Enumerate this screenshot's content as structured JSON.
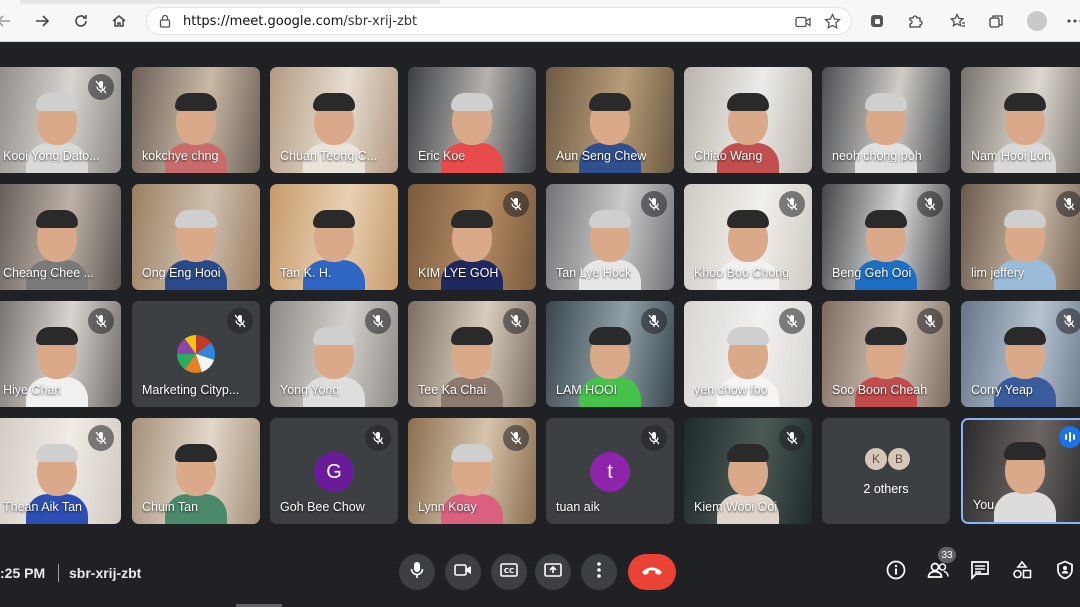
{
  "browser": {
    "url_host": "https://meet.google.com",
    "url_path": "/sbr-xrij-zbt"
  },
  "colors": {
    "tile_bg": "#3c4043",
    "end_call": "#ea4335",
    "speaking_border": "#8ab4f8",
    "avatar_g": "#6a1b9a",
    "avatar_t": "#8e24aa"
  },
  "participants": [
    {
      "name": "Kooi Yong Dato...",
      "muted": true
    },
    {
      "name": "kokchye chng",
      "muted": false
    },
    {
      "name": "Chuan Teong C...",
      "muted": false
    },
    {
      "name": "Eric Koe",
      "muted": false
    },
    {
      "name": "Aun Seng Chew",
      "muted": false
    },
    {
      "name": "Chiao Wang",
      "muted": false
    },
    {
      "name": "neoh chong poh",
      "muted": false
    },
    {
      "name": "Nam Hooi Lon",
      "muted": false
    },
    {
      "name": "Cheang Chee ...",
      "muted": false
    },
    {
      "name": "Ong Eng Hooi",
      "muted": false
    },
    {
      "name": "Tan K. H.",
      "muted": false
    },
    {
      "name": "KIM LYE GOH",
      "muted": true
    },
    {
      "name": "Tan Lye Hock",
      "muted": true
    },
    {
      "name": "Khoo Boo Chong",
      "muted": true
    },
    {
      "name": "Beng Geh Ooi",
      "muted": true
    },
    {
      "name": "lim jeffery",
      "muted": true
    },
    {
      "name": "Hiye Chan",
      "muted": true
    },
    {
      "name": "Marketing Cityp...",
      "muted": true
    },
    {
      "name": "Yong Yong",
      "muted": true
    },
    {
      "name": "Tee Ka Chai",
      "muted": true
    },
    {
      "name": "LAM HOOI",
      "muted": true
    },
    {
      "name": "yen chow foo",
      "muted": true
    },
    {
      "name": "Soo Boon Cheah",
      "muted": true
    },
    {
      "name": "Corry Yeap",
      "muted": true
    },
    {
      "name": "Thean Aik Tan",
      "muted": true
    },
    {
      "name": "Chuin Tan",
      "muted": false
    },
    {
      "name": "Goh Bee Chow",
      "muted": true,
      "avatar_letter": "G"
    },
    {
      "name": "Lynn Koay",
      "muted": true
    },
    {
      "name": "tuan aik",
      "muted": true,
      "avatar_letter": "t"
    },
    {
      "name": "Kiem Wooi Ooi",
      "muted": true
    },
    {
      "name": "2 others",
      "others": [
        "K",
        "B"
      ]
    },
    {
      "name": "You",
      "speaking": true
    }
  ],
  "meeting": {
    "time": ":25 PM",
    "code": "sbr-xrij-zbt",
    "participant_count": "33"
  },
  "controls": [
    {
      "icon": "mic-icon"
    },
    {
      "icon": "camera-icon"
    },
    {
      "icon": "captions-icon"
    },
    {
      "icon": "present-icon"
    },
    {
      "icon": "more-options-icon"
    },
    {
      "icon": "end-call-icon"
    }
  ],
  "right_controls": [
    {
      "icon": "info-icon"
    },
    {
      "icon": "people-icon"
    },
    {
      "icon": "chat-icon"
    },
    {
      "icon": "activities-icon"
    },
    {
      "icon": "host-controls-icon"
    }
  ]
}
